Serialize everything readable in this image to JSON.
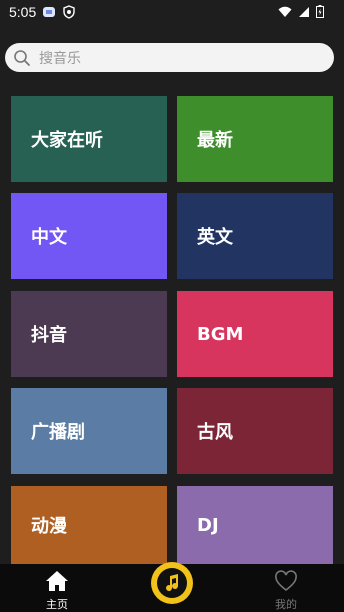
{
  "status": {
    "time": "5:05"
  },
  "search": {
    "placeholder": "搜音乐"
  },
  "categories": [
    {
      "label": "大家在听",
      "color": "#266153"
    },
    {
      "label": "最新",
      "color": "#3f8e2c"
    },
    {
      "label": "中文",
      "color": "#7257f5"
    },
    {
      "label": "英文",
      "color": "#213462"
    },
    {
      "label": "抖音",
      "color": "#4b3a51"
    },
    {
      "label": "BGM",
      "color": "#d7345e"
    },
    {
      "label": "广播剧",
      "color": "#5b7ca4"
    },
    {
      "label": "古风",
      "color": "#7c2537"
    },
    {
      "label": "动漫",
      "color": "#b05f23"
    },
    {
      "label": "DJ",
      "color": "#8b6bab"
    }
  ],
  "nav": {
    "home": "主页",
    "mine": "我的"
  },
  "icons": {
    "search": "search-icon",
    "home": "home-icon",
    "mine": "heart-icon",
    "center": "music-note-icon"
  }
}
